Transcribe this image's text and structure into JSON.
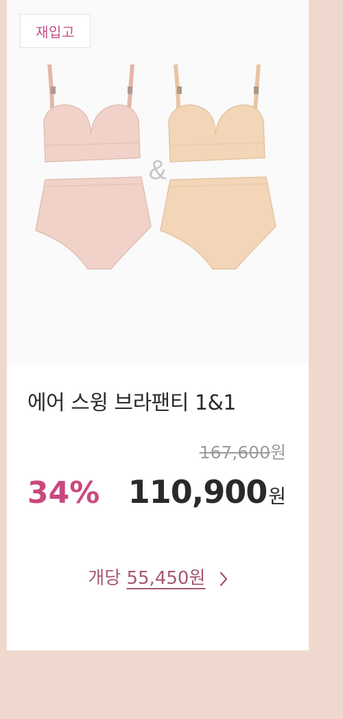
{
  "badge": {
    "label": "재입고"
  },
  "product": {
    "ampersand": "&",
    "title": "에어 스윙 브라팬티 1&1",
    "original_price": "167,600",
    "original_currency": "원",
    "discount_rate": "34%",
    "sale_price": "110,900",
    "sale_currency": "원",
    "unit_label": "개당",
    "unit_price": "55,450원"
  },
  "icons": {
    "unit_link": "chevron-right-icon"
  },
  "colors": {
    "background": "#efd9ce",
    "accent_pink": "#c9497f",
    "unit_link": "#a5566f",
    "set_left": "#f1d2c9",
    "set_right": "#f3d6b7"
  }
}
